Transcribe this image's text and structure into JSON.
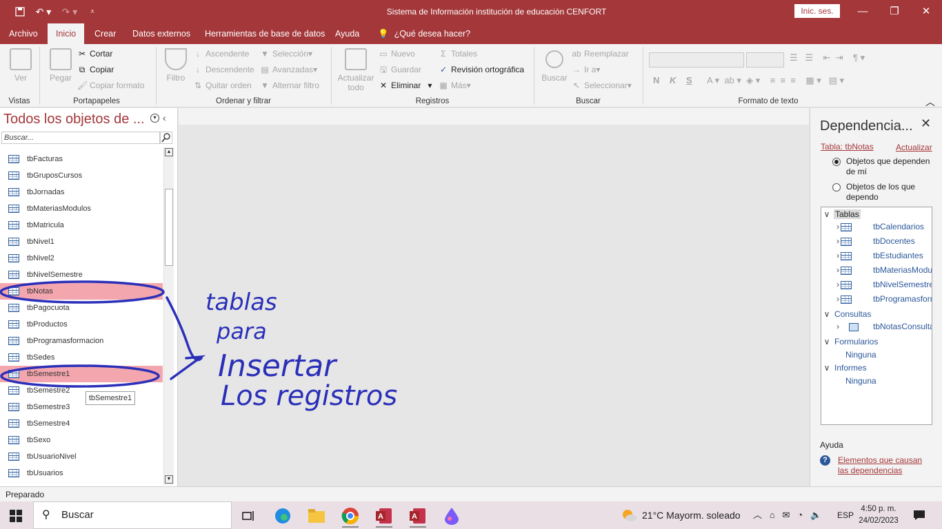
{
  "titlebar": {
    "title": "Sistema de Información institución de educación CENFORT",
    "signin": "Inic. ses.",
    "minimize": "—",
    "restore": "❐",
    "close": "✕"
  },
  "tabs": [
    "Archivo",
    "Inicio",
    "Crear",
    "Datos externos",
    "Herramientas de base de datos",
    "Ayuda",
    "¿Qué desea hacer?"
  ],
  "ribbon": {
    "vistas": {
      "ver": "Ver",
      "group": "Vistas"
    },
    "portapapeles": {
      "pegar": "Pegar",
      "cortar": "Cortar",
      "copiar": "Copiar",
      "copiar_formato": "Copiar formato",
      "group": "Portapapeles"
    },
    "ordenar": {
      "filtro": "Filtro",
      "ascendente": "Ascendente",
      "descendente": "Descendente",
      "quitar_orden": "Quitar orden",
      "seleccion": "Selección",
      "avanzadas": "Avanzadas",
      "alternar_filtro": "Alternar filtro",
      "group": "Ordenar y filtrar"
    },
    "registros": {
      "actualizar": "Actualizar",
      "todo": "todo",
      "nuevo": "Nuevo",
      "guardar": "Guardar",
      "eliminar": "Eliminar",
      "totales": "Totales",
      "revision": "Revisión ortográfica",
      "mas": "Más",
      "group": "Registros"
    },
    "buscar": {
      "buscar": "Buscar",
      "reemplazar": "Reemplazar",
      "ir_a": "Ir a",
      "seleccionar": "Seleccionar",
      "group": "Buscar"
    },
    "formato": {
      "group": "Formato de texto",
      "n": "N",
      "k": "K",
      "s": "S"
    }
  },
  "nav": {
    "title": "Todos los objetos de ...",
    "search_placeholder": "Buscar...",
    "items": [
      "tbFacturas",
      "tbGruposCursos",
      "tbJornadas",
      "tbMateriasModulos",
      "tbMatricula",
      "tbNivel1",
      "tbNivel2",
      "tbNivelSemestre",
      "tbNotas",
      "tbPagocuota",
      "tbProductos",
      "tbProgramasformacion",
      "tbSedes",
      "tbSemestre1",
      "tbSemestre2",
      "tbSemestre3",
      "tbSemestre4",
      "tbSexo",
      "tbUsuarioNivel",
      "tbUsuarios"
    ],
    "tooltip": "tbSemestre1"
  },
  "annotation": {
    "line1": "tablas",
    "line2": "para",
    "line3": "Insertar",
    "line4": "Los registros"
  },
  "dependencies": {
    "title": "Dependencia...",
    "table_link": "Tabla: tbNotas",
    "refresh_link": "Actualizar",
    "option1": "Objetos que dependen de mí",
    "option2": "Objetos de los que dependo",
    "tree": {
      "tablas": "Tablas",
      "tables": [
        "tbCalendarios",
        "tbDocentes",
        "tbEstudiantes",
        "tbMateriasModu",
        "tbNivelSemestre",
        "tbProgramasforn"
      ],
      "consultas": "Consultas",
      "queries": [
        "tbNotasConsulta"
      ],
      "formularios": "Formularios",
      "formularios_none": "Ninguna",
      "informes": "Informes",
      "informes_none": "Ninguna"
    },
    "help_label": "Ayuda",
    "help_link": "Elementos que causan las dependencias"
  },
  "status": {
    "text": "Preparado"
  },
  "taskbar": {
    "search": "Buscar",
    "weather": "21°C  Mayorm. soleado",
    "lang": "ESP",
    "time": "4:50 p. m.",
    "date": "24/02/2023"
  },
  "colors": {
    "accent": "#a4373a",
    "selection": "#f4a6ae",
    "ink": "#2a2fb8"
  }
}
